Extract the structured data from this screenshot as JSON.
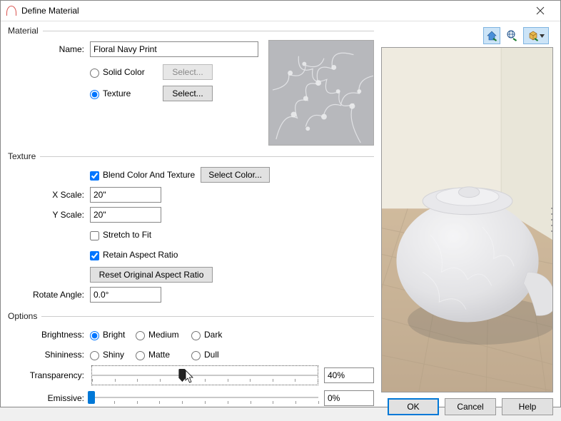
{
  "title": "Define Material",
  "material": {
    "legend": "Material",
    "nameLabel": "Name:",
    "nameValue": "Floral Navy Print",
    "solidColorLabel": "Solid Color",
    "solidSelectLabel": "Select...",
    "textureLabel": "Texture",
    "textureSelectLabel": "Select..."
  },
  "texture": {
    "legend": "Texture",
    "blendLabel": "Blend Color And Texture",
    "selectColorLabel": "Select Color...",
    "xScaleLabel": "X Scale:",
    "xScaleValue": "20\"",
    "yScaleLabel": "Y Scale:",
    "yScaleValue": "20\"",
    "stretchLabel": "Stretch to Fit",
    "retainLabel": "Retain Aspect Ratio",
    "resetLabel": "Reset Original Aspect Ratio",
    "rotateLabel": "Rotate Angle:",
    "rotateValue": "0.0°"
  },
  "options": {
    "legend": "Options",
    "brightnessLabel": "Brightness:",
    "brightLabel": "Bright",
    "mediumLabel": "Medium",
    "darkLabel": "Dark",
    "shininessLabel": "Shininess:",
    "shinyLabel": "Shiny",
    "matteLabel": "Matte",
    "dullLabel": "Dull",
    "transparencyLabel": "Transparency:",
    "transparencyValue": "40%",
    "transparencyPercent": 40,
    "emissiveLabel": "Emissive:",
    "emissiveValue": "0%",
    "emissivePercent": 0
  },
  "buttons": {
    "ok": "OK",
    "cancel": "Cancel",
    "help": "Help"
  },
  "toolbar": {
    "icon1": "home-check-icon",
    "icon2": "globe-check-icon",
    "icon3": "box-check-icon"
  }
}
